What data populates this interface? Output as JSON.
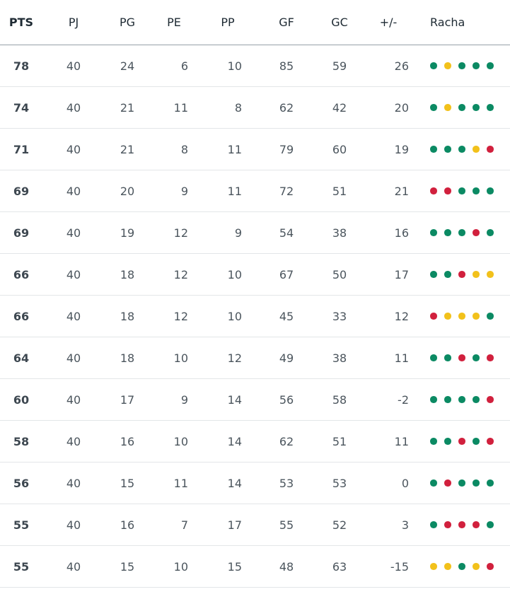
{
  "colors": {
    "W": "#0b8a63",
    "D": "#f2c11b",
    "L": "#d1203d"
  },
  "headers": {
    "pts": "PTS",
    "pj": "PJ",
    "pg": "PG",
    "pe": "PE",
    "pp": "PP",
    "gf": "GF",
    "gc": "GC",
    "dif": "+/-",
    "racha": "Racha"
  },
  "rows": [
    {
      "pts": "78",
      "pj": "40",
      "pg": "24",
      "pe": "6",
      "pp": "10",
      "gf": "85",
      "gc": "59",
      "dif": "26",
      "racha": [
        "W",
        "D",
        "W",
        "W",
        "W"
      ]
    },
    {
      "pts": "74",
      "pj": "40",
      "pg": "21",
      "pe": "11",
      "pp": "8",
      "gf": "62",
      "gc": "42",
      "dif": "20",
      "racha": [
        "W",
        "D",
        "W",
        "W",
        "W"
      ]
    },
    {
      "pts": "71",
      "pj": "40",
      "pg": "21",
      "pe": "8",
      "pp": "11",
      "gf": "79",
      "gc": "60",
      "dif": "19",
      "racha": [
        "W",
        "W",
        "W",
        "D",
        "L"
      ]
    },
    {
      "pts": "69",
      "pj": "40",
      "pg": "20",
      "pe": "9",
      "pp": "11",
      "gf": "72",
      "gc": "51",
      "dif": "21",
      "racha": [
        "L",
        "L",
        "W",
        "W",
        "W"
      ]
    },
    {
      "pts": "69",
      "pj": "40",
      "pg": "19",
      "pe": "12",
      "pp": "9",
      "gf": "54",
      "gc": "38",
      "dif": "16",
      "racha": [
        "W",
        "W",
        "W",
        "L",
        "W"
      ]
    },
    {
      "pts": "66",
      "pj": "40",
      "pg": "18",
      "pe": "12",
      "pp": "10",
      "gf": "67",
      "gc": "50",
      "dif": "17",
      "racha": [
        "W",
        "W",
        "L",
        "D",
        "D"
      ]
    },
    {
      "pts": "66",
      "pj": "40",
      "pg": "18",
      "pe": "12",
      "pp": "10",
      "gf": "45",
      "gc": "33",
      "dif": "12",
      "racha": [
        "L",
        "D",
        "D",
        "D",
        "W"
      ]
    },
    {
      "pts": "64",
      "pj": "40",
      "pg": "18",
      "pe": "10",
      "pp": "12",
      "gf": "49",
      "gc": "38",
      "dif": "11",
      "racha": [
        "W",
        "W",
        "L",
        "W",
        "L"
      ]
    },
    {
      "pts": "60",
      "pj": "40",
      "pg": "17",
      "pe": "9",
      "pp": "14",
      "gf": "56",
      "gc": "58",
      "dif": "-2",
      "racha": [
        "W",
        "W",
        "W",
        "W",
        "L"
      ]
    },
    {
      "pts": "58",
      "pj": "40",
      "pg": "16",
      "pe": "10",
      "pp": "14",
      "gf": "62",
      "gc": "51",
      "dif": "11",
      "racha": [
        "W",
        "W",
        "L",
        "W",
        "L"
      ]
    },
    {
      "pts": "56",
      "pj": "40",
      "pg": "15",
      "pe": "11",
      "pp": "14",
      "gf": "53",
      "gc": "53",
      "dif": "0",
      "racha": [
        "W",
        "L",
        "W",
        "W",
        "W"
      ]
    },
    {
      "pts": "55",
      "pj": "40",
      "pg": "16",
      "pe": "7",
      "pp": "17",
      "gf": "55",
      "gc": "52",
      "dif": "3",
      "racha": [
        "W",
        "L",
        "L",
        "L",
        "W"
      ]
    },
    {
      "pts": "55",
      "pj": "40",
      "pg": "15",
      "pe": "10",
      "pp": "15",
      "gf": "48",
      "gc": "63",
      "dif": "-15",
      "racha": [
        "D",
        "D",
        "W",
        "D",
        "L"
      ]
    }
  ]
}
